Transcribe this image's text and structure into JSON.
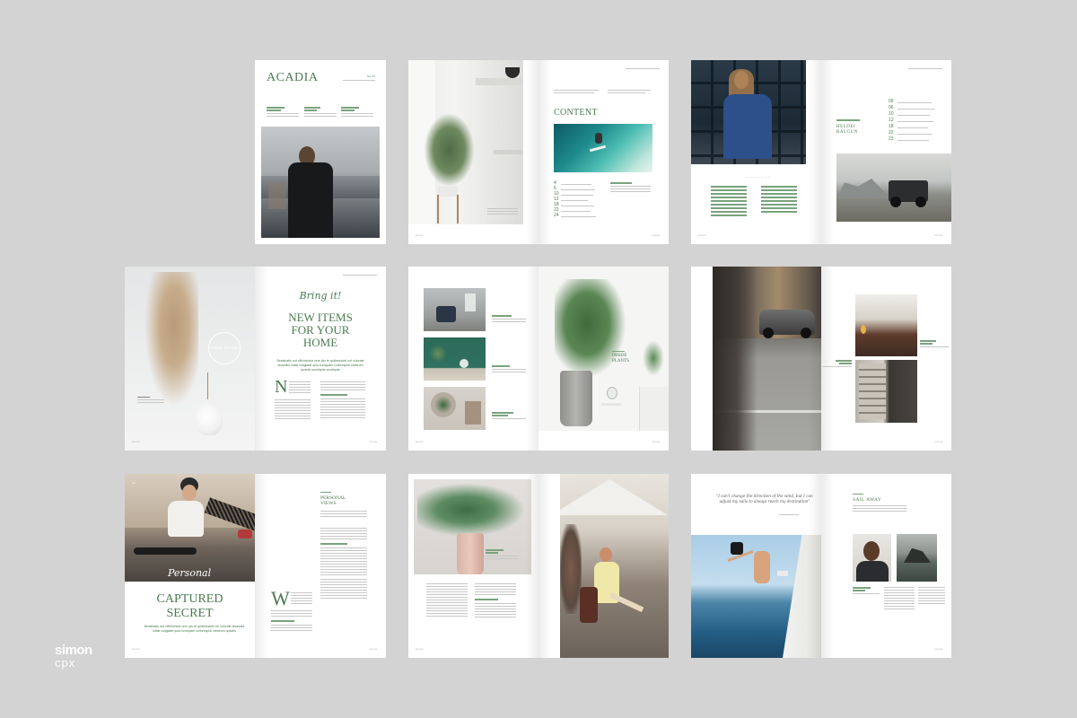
{
  "brand": {
    "name": "ACADIA",
    "accent": "#4d7a52",
    "issue": "No. 01"
  },
  "watermark": {
    "line1": "simon",
    "line2": "cpx"
  },
  "cover": {
    "title": "ACADIA",
    "issue": "No. 01"
  },
  "contents": {
    "title": "CONTENT",
    "page_numbers": [
      "4",
      "6",
      "10",
      "12",
      "18",
      "22",
      "24"
    ]
  },
  "index_page": {
    "heading_line1": "HELDEI",
    "heading_line2": "BALGUN",
    "numbers": [
      "09",
      "06",
      "10",
      "12",
      "18",
      "22",
      "23"
    ]
  },
  "new_items": {
    "script_line": "Bring it!",
    "title_line1": "NEW ITEMS",
    "title_line2": "FOR YOUR",
    "title_line3": "HOME",
    "intro": "Beatsbatis aut officimincta vere ipic te quibeanded unt volorate alsaintiut istiae voligtatet quia sumquam vollorespidi orestrum quasits sundiqute sundiqute",
    "drop_cap": "N",
    "badge": "Meet Home"
  },
  "plants": {
    "caption_line1": "INSIDE",
    "caption_line2": "PLANTS"
  },
  "captured": {
    "script_line": "Personal",
    "title_line1": "CAPTURED",
    "title_line2": "SECRET",
    "intro": "Beatsbatis aut officimincta vere ipic te quibeanded unt volorate alsaintiut istiae voligtatet quia sumquam vollorespidi orestrum quasits",
    "drop_cap": "W",
    "side_heading_line1": "PERSONAL",
    "side_heading_line2": "VIEWS"
  },
  "sail": {
    "quote": "\"I can't change the direction of the wind, but I can adjust my sails to always reach my destination\"",
    "heading": "SAIL AWAY"
  }
}
